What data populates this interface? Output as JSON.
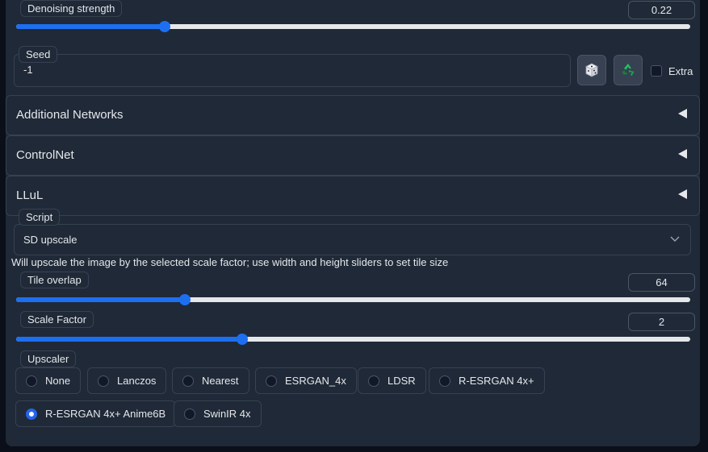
{
  "denoising": {
    "label": "Denoising strength",
    "value": "0.22",
    "fraction": 0.22
  },
  "seed": {
    "label": "Seed",
    "value": "-1",
    "extra_label": "Extra",
    "dice_icon": "dice-icon",
    "recycle_icon": "recycle-icon"
  },
  "accordions": [
    {
      "title": "Additional Networks"
    },
    {
      "title": "ControlNet"
    },
    {
      "title": "LLuL"
    }
  ],
  "script": {
    "label": "Script",
    "selected": "SD upscale",
    "description": "Will upscale the image by the selected scale factor; use width and height sliders to set tile size"
  },
  "tile_overlap": {
    "label": "Tile overlap",
    "value": "64",
    "fraction": 0.25
  },
  "scale_factor": {
    "label": "Scale Factor",
    "value": "2",
    "fraction": 0.335
  },
  "upscaler": {
    "label": "Upscaler",
    "options": [
      "None",
      "Lanczos",
      "Nearest",
      "ESRGAN_4x",
      "LDSR",
      "R-ESRGAN 4x+",
      "R-ESRGAN 4x+ Anime6B",
      "SwinIR 4x"
    ],
    "selected": "R-ESRGAN 4x+ Anime6B"
  },
  "colors": {
    "accent": "#1d6ff2",
    "panel": "#1f2937",
    "background": "#0b0f19"
  }
}
